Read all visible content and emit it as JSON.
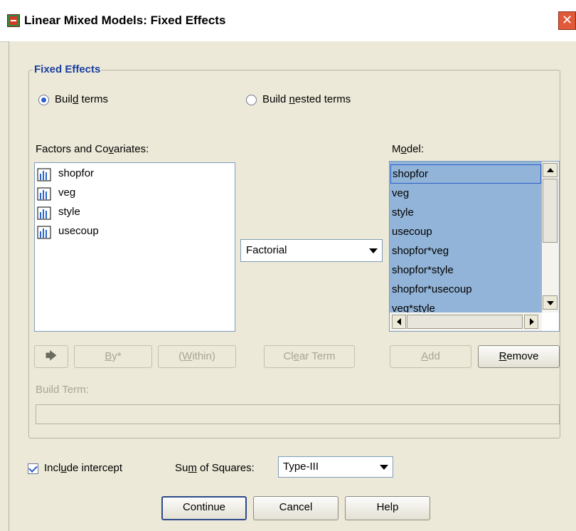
{
  "window": {
    "title": "Linear Mixed Models: Fixed Effects",
    "close_icon": "close-icon"
  },
  "fixed_effects": {
    "legend": "Fixed Effects",
    "radio_build_terms": {
      "label_pre": "Buil",
      "label_mnemonic": "d",
      "label_post": " terms",
      "selected": true
    },
    "radio_build_nested": {
      "label_pre": "Build ",
      "label_mnemonic": "n",
      "label_post": "ested terms",
      "selected": false
    },
    "factors_label": {
      "pre": "Factors and Co",
      "mnemonic": "v",
      "post": "ariates:"
    },
    "factors": [
      {
        "name": "shopfor",
        "icon": "nominal-variable-icon"
      },
      {
        "name": "veg",
        "icon": "nominal-variable-icon"
      },
      {
        "name": "style",
        "icon": "nominal-variable-icon"
      },
      {
        "name": "usecoup",
        "icon": "nominal-variable-icon"
      }
    ],
    "term_type": {
      "selected": "Factorial"
    },
    "model_label": {
      "pre": "M",
      "mnemonic": "o",
      "post": "del:"
    },
    "model_items": [
      "shopfor",
      "veg",
      "style",
      "usecoup",
      "shopfor*veg",
      "shopfor*style",
      "shopfor*usecoup",
      "veg*style"
    ],
    "buttons": {
      "move_arrow": "move-right-icon",
      "by": {
        "mnemonic": "B",
        "post": "y*"
      },
      "within": {
        "pre": "(",
        "mnemonic": "W",
        "post": "ithin)"
      },
      "clear_term": {
        "pre": "Cl",
        "mnemonic": "e",
        "post": "ar Term"
      },
      "add": {
        "mnemonic": "A",
        "post": "dd"
      },
      "remove": {
        "mnemonic": "R",
        "post": "emove"
      }
    },
    "build_term_label": "Build Term:",
    "build_term_value": ""
  },
  "footer": {
    "include_intercept": {
      "pre": "Incl",
      "mnemonic": "u",
      "post": "de intercept",
      "checked": true
    },
    "sum_of_squares_label": {
      "pre": "Su",
      "mnemonic": "m",
      "post": " of Squares:"
    },
    "sum_of_squares_value": "Type-III",
    "continue": "Continue",
    "cancel": "Cancel",
    "help": "Help"
  }
}
